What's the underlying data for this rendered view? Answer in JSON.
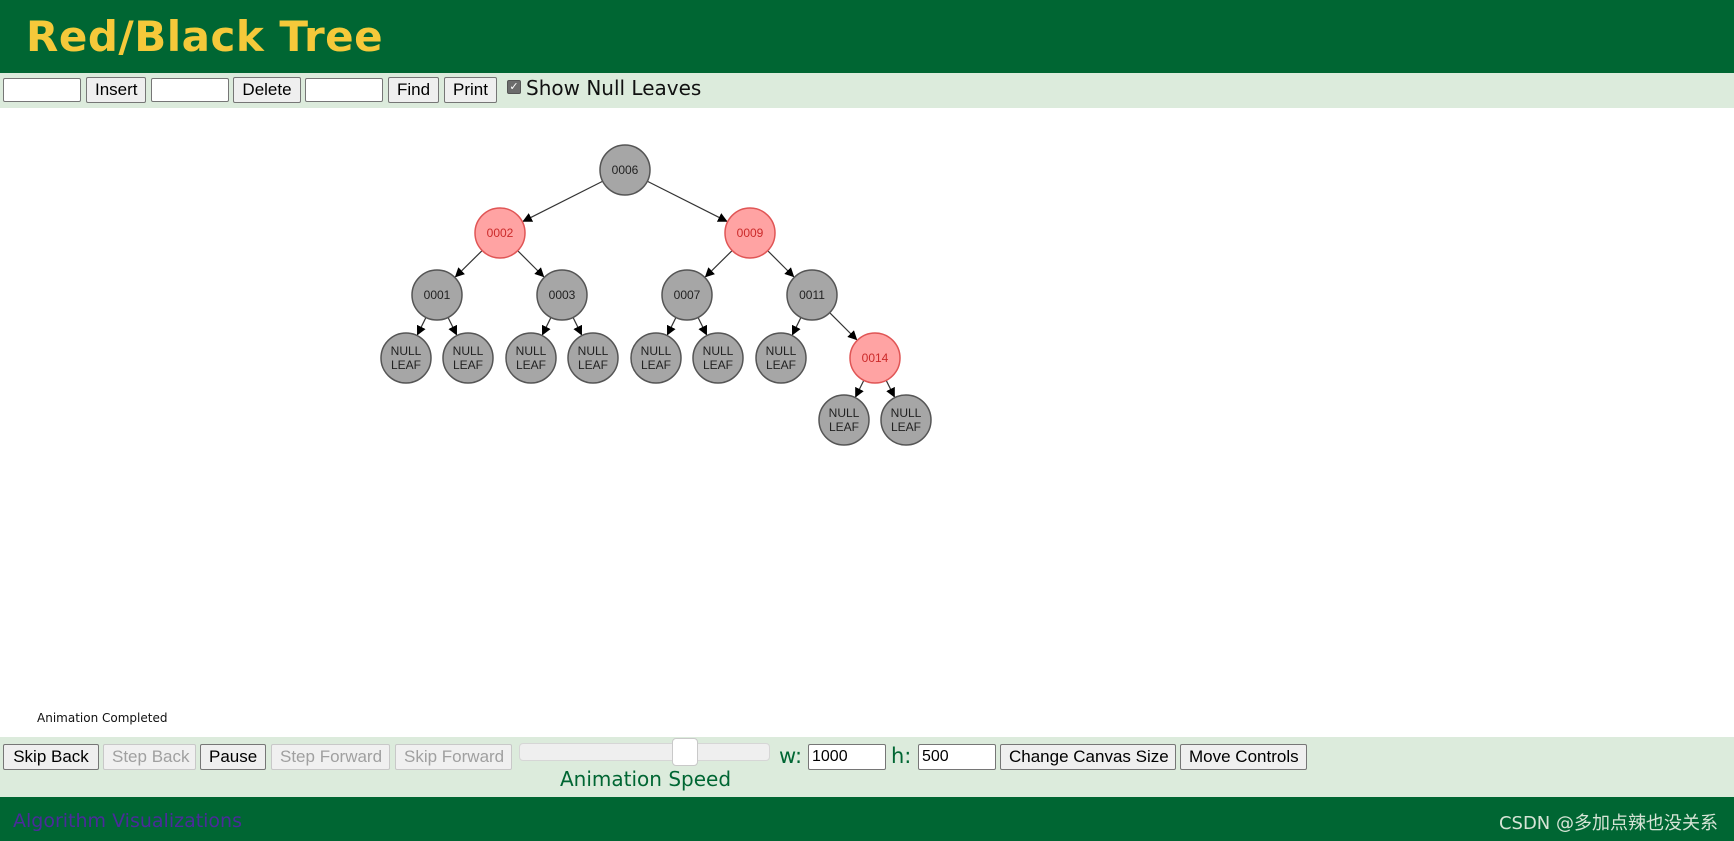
{
  "header": {
    "title": "Red/Black Tree"
  },
  "top_controls": {
    "insert_value": "",
    "insert_label": "Insert",
    "delete_value": "",
    "delete_label": "Delete",
    "find_value": "",
    "find_label": "Find",
    "print_label": "Print",
    "show_null_leaves_label": "Show Null Leaves",
    "show_null_leaves_checked": true
  },
  "tree": {
    "colors": {
      "black_fill": "#a6a6a6",
      "black_text": "#222222",
      "red_fill": "#ffa3a3",
      "red_text": "#cc2a2a",
      "stroke": "#555555"
    },
    "nodes": [
      {
        "id": "n6",
        "label": "0006",
        "color": "black"
      },
      {
        "id": "n2",
        "label": "0002",
        "color": "red"
      },
      {
        "id": "n9",
        "label": "0009",
        "color": "red"
      },
      {
        "id": "n1",
        "label": "0001",
        "color": "black"
      },
      {
        "id": "n3",
        "label": "0003",
        "color": "black"
      },
      {
        "id": "n7",
        "label": "0007",
        "color": "black"
      },
      {
        "id": "n11",
        "label": "0011",
        "color": "black"
      },
      {
        "id": "n14",
        "label": "0014",
        "color": "red"
      },
      {
        "id": "l1a",
        "label": "NULL LEAF",
        "color": "black"
      },
      {
        "id": "l1b",
        "label": "NULL LEAF",
        "color": "black"
      },
      {
        "id": "l3a",
        "label": "NULL LEAF",
        "color": "black"
      },
      {
        "id": "l3b",
        "label": "NULL LEAF",
        "color": "black"
      },
      {
        "id": "l7a",
        "label": "NULL LEAF",
        "color": "black"
      },
      {
        "id": "l7b",
        "label": "NULL LEAF",
        "color": "black"
      },
      {
        "id": "l11a",
        "label": "NULL LEAF",
        "color": "black"
      },
      {
        "id": "l14a",
        "label": "NULL LEAF",
        "color": "black"
      },
      {
        "id": "l14b",
        "label": "NULL LEAF",
        "color": "black"
      }
    ],
    "edges": [
      [
        "n6",
        "n2"
      ],
      [
        "n6",
        "n9"
      ],
      [
        "n2",
        "n1"
      ],
      [
        "n2",
        "n3"
      ],
      [
        "n9",
        "n7"
      ],
      [
        "n9",
        "n11"
      ],
      [
        "n1",
        "l1a"
      ],
      [
        "n1",
        "l1b"
      ],
      [
        "n3",
        "l3a"
      ],
      [
        "n3",
        "l3b"
      ],
      [
        "n7",
        "l7a"
      ],
      [
        "n7",
        "l7b"
      ],
      [
        "n11",
        "l11a"
      ],
      [
        "n11",
        "n14"
      ],
      [
        "n14",
        "l14a"
      ],
      [
        "n14",
        "l14b"
      ]
    ]
  },
  "status": "Animation Completed",
  "bottom_controls": {
    "skip_back": "Skip Back",
    "step_back": "Step Back",
    "pause": "Pause",
    "step_forward": "Step Forward",
    "skip_forward": "Skip Forward",
    "animation_speed_label": "Animation Speed",
    "animation_speed_fraction": 0.68,
    "w_label": "w:",
    "w_value": "1000",
    "h_label": "h:",
    "h_value": "500",
    "change_canvas_size": "Change Canvas Size",
    "move_controls": "Move Controls"
  },
  "footer": {
    "link_text": "Algorithm Visualizations",
    "watermark": "CSDN @多加点辣也没关系"
  }
}
